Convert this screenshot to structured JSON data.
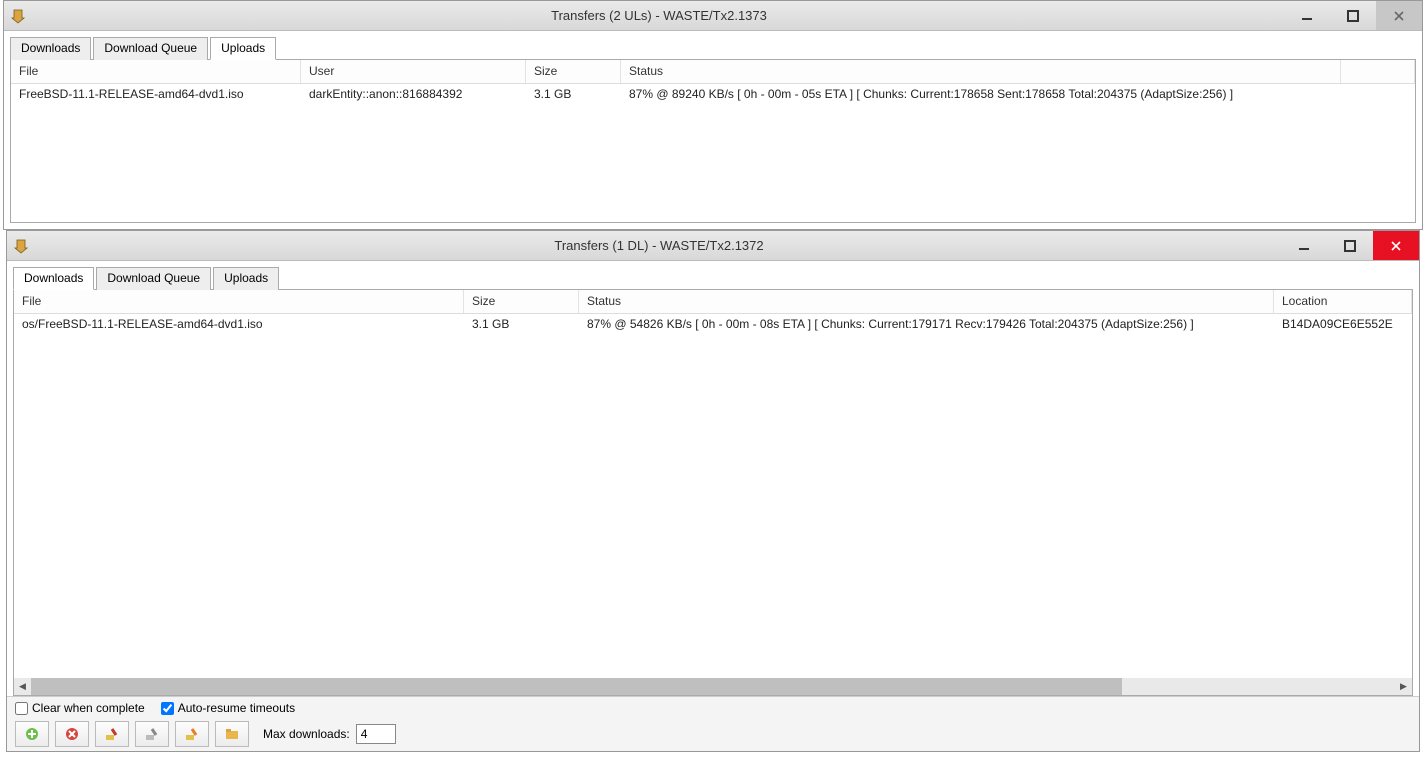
{
  "window1": {
    "title": "Transfers (2 ULs) - WASTE/Tx2.1373",
    "tabs": [
      "Downloads",
      "Download Queue",
      "Uploads"
    ],
    "active_tab": 2,
    "columns": [
      "File",
      "User",
      "Size",
      "Status"
    ],
    "row": {
      "file": "FreeBSD-11.1-RELEASE-amd64-dvd1.iso",
      "user": "darkEntity::anon::816884392",
      "size": "3.1 GB",
      "status": "87% @ 89240 KB/s [ 0h - 00m - 05s ETA ] [ Chunks: Current:178658 Sent:178658 Total:204375 (AdaptSize:256) ]"
    }
  },
  "window2": {
    "title": "Transfers (1 DL) - WASTE/Tx2.1372",
    "tabs": [
      "Downloads",
      "Download Queue",
      "Uploads"
    ],
    "active_tab": 0,
    "columns": [
      "File",
      "Size",
      "Status",
      "Location"
    ],
    "row": {
      "file": "os/FreeBSD-11.1-RELEASE-amd64-dvd1.iso",
      "size": "3.1 GB",
      "status": "87% @ 54826 KB/s [ 0h - 00m - 08s ETA ] [ Chunks: Current:179171 Recv:179426 Total:204375 (AdaptSize:256) ]",
      "location": "B14DA09CE6E552E"
    },
    "checkboxes": {
      "clear_label": "Clear when complete",
      "clear_checked": false,
      "auto_label": "Auto-resume timeouts",
      "auto_checked": true
    },
    "maxdl_label": "Max downloads:",
    "maxdl_value": "4"
  }
}
